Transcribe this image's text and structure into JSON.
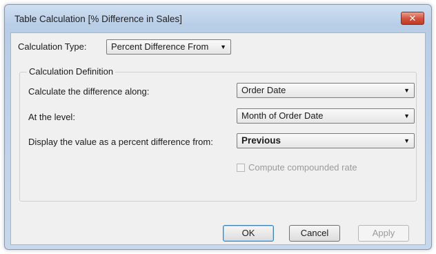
{
  "dialog": {
    "title": "Table Calculation [% Difference in Sales]",
    "close_label": "✕"
  },
  "calc_type": {
    "label": "Calculation Type:",
    "value": "Percent Difference From"
  },
  "definition": {
    "legend": "Calculation Definition",
    "along_label": "Calculate the difference along:",
    "along_value": "Order Date",
    "level_label": "At the level:",
    "level_value": "Month of Order Date",
    "from_label": "Display the value as a percent difference from:",
    "from_value": "Previous",
    "compound_label": "Compute compounded rate",
    "compound_checked": false,
    "compound_enabled": false
  },
  "buttons": {
    "ok": "OK",
    "cancel": "Cancel",
    "apply": "Apply"
  },
  "icons": {
    "dropdown_arrow": "▼"
  },
  "colors": {
    "close_button": "#c13b24",
    "ok_focus_border": "#3c7fb1"
  }
}
